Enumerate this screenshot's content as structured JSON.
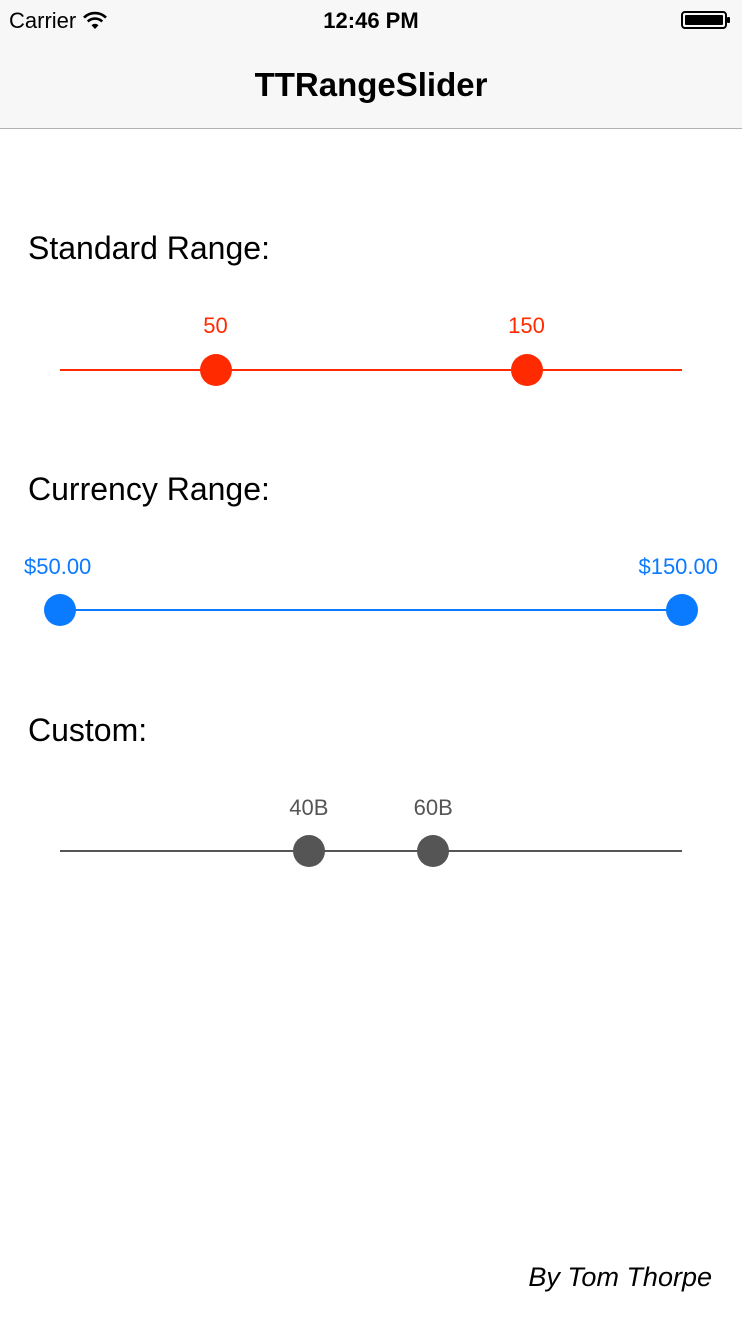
{
  "status_bar": {
    "carrier": "Carrier",
    "time": "12:46 PM",
    "wifi_icon": "wifi-icon",
    "battery_icon": "battery-full-icon"
  },
  "nav": {
    "title": "TTRangeSlider"
  },
  "sliders": {
    "standard": {
      "label": "Standard Range:",
      "color": "#ff2a00",
      "min": 0,
      "max": 200,
      "selected_min": 50,
      "selected_max": 150,
      "min_label": "50",
      "max_label": "150"
    },
    "currency": {
      "label": "Currency Range:",
      "color": "#0a7aff",
      "min": 50,
      "max": 150,
      "selected_min": 50,
      "selected_max": 150,
      "min_label": "$50.00",
      "max_label": "$150.00"
    },
    "custom": {
      "label": "Custom:",
      "color": "#555555",
      "min": 0,
      "max": 100,
      "selected_min": 40,
      "selected_max": 60,
      "min_label": "40B",
      "max_label": "60B"
    }
  },
  "footer": {
    "author": "By Tom Thorpe"
  }
}
